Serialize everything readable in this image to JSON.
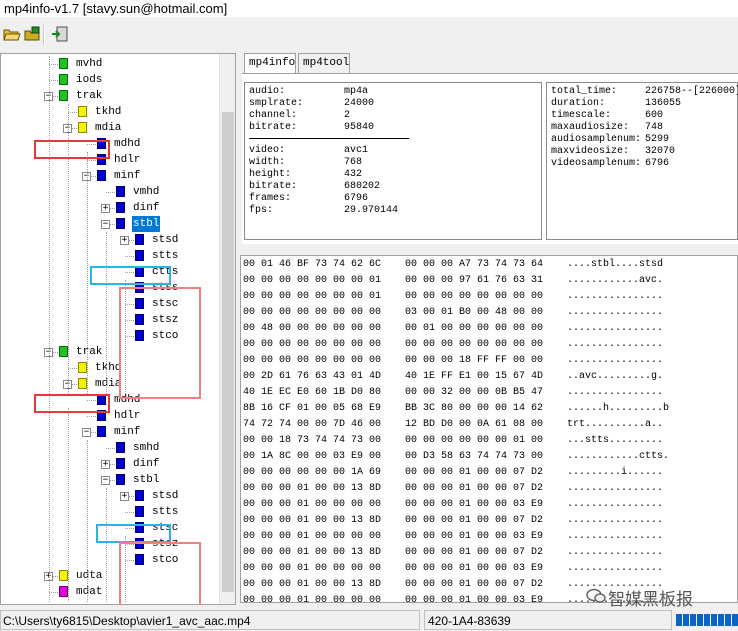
{
  "window": {
    "title": "mp4info-v1.7 [stavy.sun@hotmail.com]"
  },
  "toolbar": {
    "buttons": [
      "open-icon",
      "open-folder-icon",
      "exit-icon"
    ]
  },
  "tree": {
    "nodes": [
      {
        "label": "mvhd",
        "icon": "green"
      },
      {
        "label": "iods",
        "icon": "green"
      },
      {
        "label": "trak",
        "icon": "green",
        "expander": "-"
      },
      {
        "label": "tkhd",
        "icon": "yellow"
      },
      {
        "label": "mdia",
        "icon": "yellow",
        "expander": "-"
      },
      {
        "label": "mdhd",
        "icon": "blue"
      },
      {
        "label": "hdlr",
        "icon": "blue"
      },
      {
        "label": "minf",
        "icon": "blue",
        "expander": "-"
      },
      {
        "label": "vmhd",
        "icon": "blue"
      },
      {
        "label": "dinf",
        "icon": "blue",
        "expander": "+"
      },
      {
        "label": "stbl",
        "icon": "blue",
        "expander": "-",
        "selected": true
      },
      {
        "label": "stsd",
        "icon": "blue",
        "expander": "+"
      },
      {
        "label": "stts",
        "icon": "blue"
      },
      {
        "label": "ctts",
        "icon": "blue"
      },
      {
        "label": "stss",
        "icon": "blue"
      },
      {
        "label": "stsc",
        "icon": "blue"
      },
      {
        "label": "stsz",
        "icon": "blue"
      },
      {
        "label": "stco",
        "icon": "blue"
      },
      {
        "label": "trak",
        "icon": "green",
        "expander": "-"
      },
      {
        "label": "tkhd",
        "icon": "yellow"
      },
      {
        "label": "mdia",
        "icon": "yellow",
        "expander": "-"
      },
      {
        "label": "mdhd",
        "icon": "blue"
      },
      {
        "label": "hdlr",
        "icon": "blue"
      },
      {
        "label": "minf",
        "icon": "blue",
        "expander": "-"
      },
      {
        "label": "smhd",
        "icon": "blue"
      },
      {
        "label": "dinf",
        "icon": "blue",
        "expander": "+"
      },
      {
        "label": "stbl",
        "icon": "blue",
        "expander": "-"
      },
      {
        "label": "stsd",
        "icon": "blue",
        "expander": "+"
      },
      {
        "label": "stts",
        "icon": "blue"
      },
      {
        "label": "stsc",
        "icon": "blue"
      },
      {
        "label": "stsz",
        "icon": "blue"
      },
      {
        "label": "stco",
        "icon": "blue"
      },
      {
        "label": "udta",
        "icon": "yellow",
        "expander": "+"
      },
      {
        "label": "mdat",
        "icon": "magenta"
      }
    ]
  },
  "tabs": [
    {
      "label": "mp4info",
      "active": true
    },
    {
      "label": "mp4tool",
      "active": false
    }
  ],
  "info_left": {
    "audio": [
      [
        "audio:",
        "mp4a"
      ],
      [
        "smplrate:",
        "24000"
      ],
      [
        "channel:",
        "2"
      ],
      [
        "bitrate:",
        "95840"
      ]
    ],
    "video": [
      [
        "video:",
        "avc1"
      ],
      [
        "width:",
        "768"
      ],
      [
        "height:",
        "432"
      ],
      [
        "bitrate:",
        "680202"
      ],
      [
        "frames:",
        "6796"
      ],
      [
        "fps:",
        "29.970144"
      ]
    ]
  },
  "info_right": [
    [
      "total_time:",
      "226758--[226000]"
    ],
    [
      "duration:",
      "136055"
    ],
    [
      "timescale:",
      "600"
    ],
    [
      "maxaudiosize:",
      "748"
    ],
    [
      "audiosamplenum:",
      "5299"
    ],
    [
      "maxvideosize:",
      "32070"
    ],
    [
      "videosamplenum:",
      "6796"
    ]
  ],
  "hex_rows": [
    [
      "00 01 46 BF 73 74 62 6C",
      "00 00 00 A7 73 74 73 64",
      "....stbl....stsd"
    ],
    [
      "00 00 00 00 00 00 00 01",
      "00 00 00 97 61 76 63 31",
      "............avc."
    ],
    [
      "00 00 00 00 00 00 00 01",
      "00 00 00 00 00 00 00 00",
      "................"
    ],
    [
      "00 00 00 00 00 00 00 00",
      "03 00 01 B0 00 48 00 00",
      "................"
    ],
    [
      "00 48 00 00 00 00 00 00",
      "00 01 00 00 00 00 00 00",
      "................"
    ],
    [
      "00 00 00 00 00 00 00 00",
      "00 00 00 00 00 00 00 00",
      "................"
    ],
    [
      "00 00 00 00 00 00 00 00",
      "00 00 00 18 FF FF 00 00",
      "................"
    ],
    [
      "00 2D 61 76 63 43 01 4D",
      "40 1E FF E1 00 15 67 4D",
      "..avc.........g."
    ],
    [
      "40 1E EC E0 60 1B D0 80",
      "00 00 32 00 00 0B B5 47",
      "................"
    ],
    [
      "8B 16 CF 01 00 05 68 E9",
      "BB 3C 80 00 00 00 14 62",
      "......h.........b"
    ],
    [
      "74 72 74 00 00 7D 46 00",
      "12 BD D0 00 0A 61 08 00",
      "trt..........a.."
    ],
    [
      "00 00 18 73 74 74 73 00",
      "00 00 00 00 00 00 01 00",
      "...stts........."
    ],
    [
      "00 1A 8C 00 00 03 E9 00",
      "00 D3 58 63 74 74 73 00",
      "............ctts."
    ],
    [
      "00 00 00 00 00 00 1A 69",
      "00 00 00 01 00 00 07 D2",
      ".........i......"
    ],
    [
      "00 00 00 01 00 00 13 8D",
      "00 00 00 01 00 00 07 D2",
      "................"
    ],
    [
      "00 00 00 01 00 00 00 00",
      "00 00 00 01 00 00 03 E9",
      "................"
    ],
    [
      "00 00 00 01 00 00 13 8D",
      "00 00 00 01 00 00 07 D2",
      "................"
    ],
    [
      "00 00 00 01 00 00 00 00",
      "00 00 00 01 00 00 03 E9",
      "................"
    ],
    [
      "00 00 00 01 00 00 13 8D",
      "00 00 00 01 00 00 07 D2",
      "................"
    ],
    [
      "00 00 00 01 00 00 00 00",
      "00 00 00 01 00 00 03 E9",
      "................"
    ],
    [
      "00 00 00 01 00 00 13 8D",
      "00 00 00 01 00 00 07 D2",
      "................"
    ],
    [
      "00 00 00 01 00 00 00 00",
      "00 00 00 01 00 00 03 E9",
      "................"
    ]
  ],
  "status": {
    "path": "C:\\Users\\ty6815\\Desktop\\avier1_avc_aac.mp4",
    "range": "420-1A4-83639",
    "progress_segments": 9
  },
  "watermark": {
    "text": "智媒黑板报"
  }
}
